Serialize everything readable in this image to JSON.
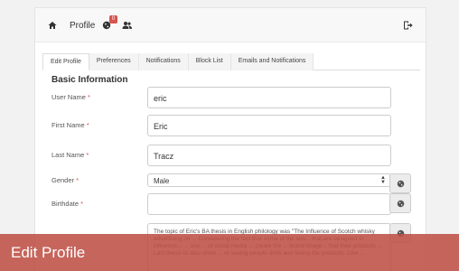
{
  "topbar": {
    "profile_label": "Profile",
    "notification_badge": "0"
  },
  "tabs": [
    {
      "label": "Edit Profile",
      "active": true
    },
    {
      "label": "Preferences"
    },
    {
      "label": "Notifications"
    },
    {
      "label": "Block List"
    },
    {
      "label": "Emails and Notifications"
    }
  ],
  "form": {
    "section_title": "Basic Information",
    "user_name": {
      "label": "User Name",
      "value": "eric"
    },
    "first_name": {
      "label": "First Name",
      "value": "Eric"
    },
    "last_name": {
      "label": "Last Name",
      "value": "Tracz"
    },
    "gender": {
      "label": "Gender",
      "value": "Male"
    },
    "birthdate": {
      "label": "Birthdate",
      "value": ""
    },
    "about": {
      "value": "The topic of Eric's BA thesis in English philology was \"The Influence of Scotch whisky advertising on ... Considering the fact that some of the ads... that are designed to influence... ... use ... of social media ... create the ... brand image... that their products ... Last thesis to also show ... of seeing people drink and loving the products. Like ..."
    }
  },
  "banner": {
    "text": "Edit Profile"
  },
  "colors": {
    "banner": "#be5046",
    "badge": "#d9534f"
  }
}
